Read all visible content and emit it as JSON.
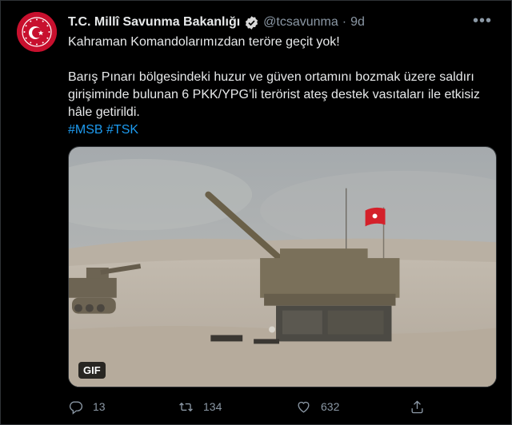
{
  "tweet": {
    "author_name": "T.C. Millî Savunma Bakanlığı",
    "handle": "@tcsavunma",
    "separator": "·",
    "time": "9d",
    "more_icon": "more-dots-icon",
    "lines": [
      "Kahraman Komandolarımızdan teröre geçit yok!",
      "Barış Pınarı bölgesindeki huzur ve güven ortamını bozmak üzere saldırı girişiminde bulunan 6 PKK/YPG’li terörist ateş destek vasıtaları ile etkisiz hâle getirildi."
    ],
    "hashtags": [
      "#MSB",
      "#TSK"
    ],
    "media": {
      "badge": "GIF"
    },
    "actions": {
      "reply_count": "13",
      "retweet_count": "134",
      "like_count": "632",
      "reply_icon": "reply-icon",
      "retweet_icon": "retweet-icon",
      "like_icon": "heart-icon",
      "share_icon": "share-icon"
    }
  },
  "colors": {
    "background": "#000000",
    "accent": "#1d9bf0",
    "muted": "#8b98a5",
    "text": "#e7e9ea",
    "avatar_red": "#c8102e"
  }
}
